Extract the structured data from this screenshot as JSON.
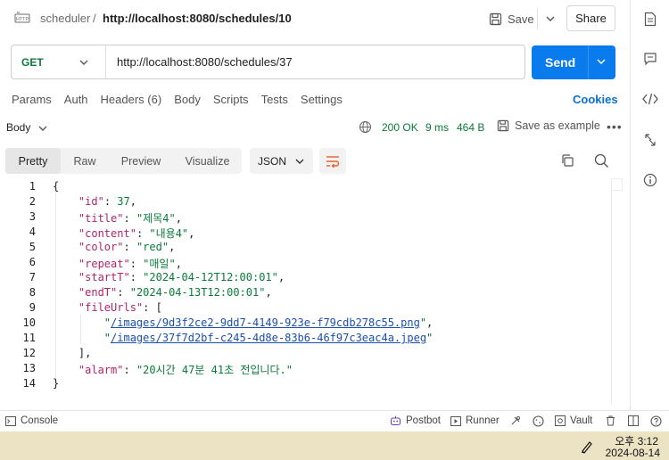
{
  "header": {
    "collection": "scheduler",
    "separator": "/",
    "request_name": "http://localhost:8080/schedules/10",
    "save_label": "Save",
    "share_label": "Share"
  },
  "request": {
    "method": "GET",
    "url": "http://localhost:8080/schedules/37",
    "send_label": "Send"
  },
  "request_tabs": [
    "Params",
    "Auth",
    "Headers (6)",
    "Body",
    "Scripts",
    "Tests",
    "Settings"
  ],
  "cookies_label": "Cookies",
  "response": {
    "body_label": "Body",
    "status": "200 OK",
    "time": "9 ms",
    "size": "464 B",
    "save_example_label": "Save as example",
    "more_label": "•••"
  },
  "view_tabs": [
    "Pretty",
    "Raw",
    "Preview",
    "Visualize"
  ],
  "active_view_tab": "Pretty",
  "format": "JSON",
  "code_lines": {
    "l1": "{",
    "l2_key": "\"id\"",
    "l2_val": "37",
    "l3_key": "\"title\"",
    "l3_val": "\"제목4\"",
    "l4_key": "\"content\"",
    "l4_val": "\"내용4\"",
    "l5_key": "\"color\"",
    "l5_val": "\"red\"",
    "l6_key": "\"repeat\"",
    "l6_val": "\"매일\"",
    "l7_key": "\"startT\"",
    "l7_val": "\"2024-04-12T12:00:01\"",
    "l8_key": "\"endT\"",
    "l8_val": "\"2024-04-13T12:00:01\"",
    "l9_key": "\"fileUrls\"",
    "l9_val": "[",
    "l10_val": "/images/9d3f2ce2-9dd7-4149-923e-f79cdb278c55.png",
    "l11_val": "/images/37f7d2bf-c245-4d8e-83b6-46f97c3eac4a.jpeg",
    "l12": "],",
    "l13_key": "\"alarm\"",
    "l13_val": "\"20시간 47분 41초 전입니다.\"",
    "l14": "}"
  },
  "line_numbers": [
    "1",
    "2",
    "3",
    "4",
    "5",
    "6",
    "7",
    "8",
    "9",
    "10",
    "11",
    "12",
    "13",
    "14"
  ],
  "statusbar": {
    "console": "Console",
    "postbot": "Postbot",
    "runner": "Runner",
    "vault": "Vault"
  },
  "taskbar": {
    "time": "오후 3:12",
    "date": "2024-08-14"
  },
  "colors": {
    "accent": "#097bed",
    "status_ok": "#0b7a3b",
    "json_key": "#b0246b",
    "link": "#0a6fd6"
  }
}
